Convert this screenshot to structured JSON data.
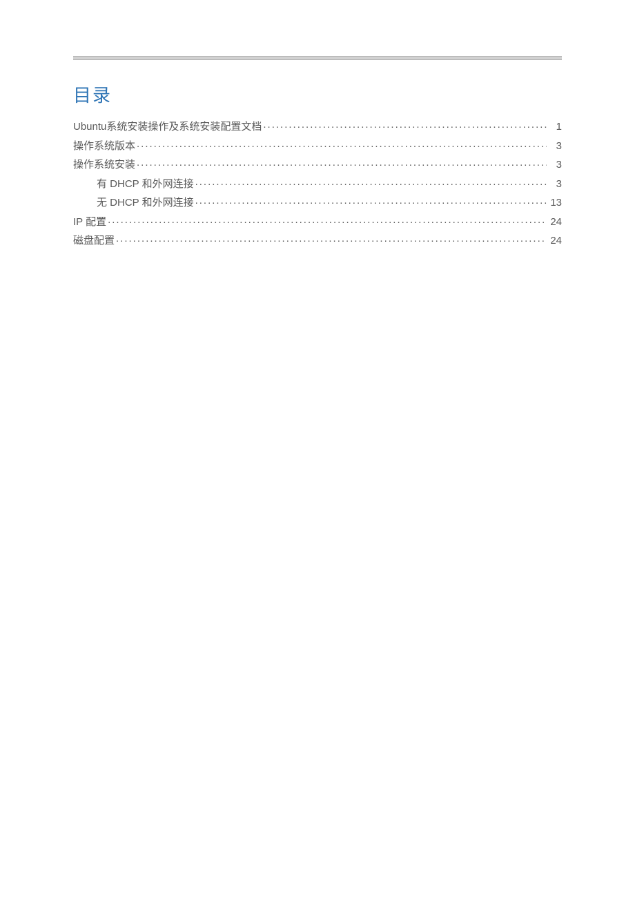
{
  "toc": {
    "heading": "目录",
    "entries": [
      {
        "title": "Ubuntu系统安装操作及系统安装配置文档",
        "page": "1",
        "level": 0
      },
      {
        "title": "操作系统版本",
        "page": "3",
        "level": 0
      },
      {
        "title": "操作系统安装",
        "page": "3",
        "level": 0
      },
      {
        "title": "有 DHCP 和外网连接",
        "page": "3",
        "level": 1
      },
      {
        "title": "无 DHCP 和外网连接",
        "page": "13",
        "level": 1
      },
      {
        "title": "IP 配置",
        "page": "24",
        "level": 0
      },
      {
        "title": "磁盘配置",
        "page": "24",
        "level": 0
      }
    ]
  }
}
